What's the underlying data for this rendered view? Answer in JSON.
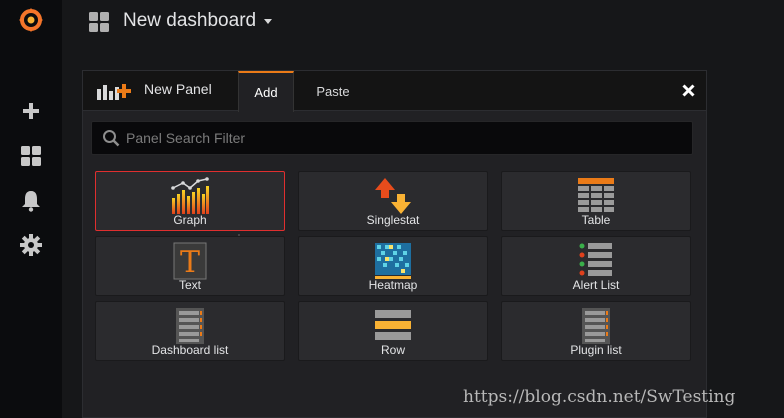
{
  "header": {
    "title": "New dashboard"
  },
  "sidebar": {
    "items": [
      {
        "name": "grafana-logo",
        "icon": "grafana-logo-icon"
      },
      {
        "name": "create",
        "icon": "plus-icon"
      },
      {
        "name": "dashboards",
        "icon": "dashboards-grid-icon"
      },
      {
        "name": "alerting",
        "icon": "bell-icon"
      },
      {
        "name": "configuration",
        "icon": "gear-icon"
      }
    ]
  },
  "panel": {
    "title": "New Panel",
    "tabs": [
      {
        "label": "Add"
      },
      {
        "label": "Paste"
      }
    ],
    "active_tab": "Add",
    "search": {
      "placeholder": "Panel Search Filter",
      "value": ""
    },
    "cards": [
      {
        "label": "Graph",
        "icon": "graph-icon",
        "selected": true
      },
      {
        "label": "Singlestat",
        "icon": "singlestat-icon"
      },
      {
        "label": "Table",
        "icon": "table-icon"
      },
      {
        "label": "Text",
        "icon": "text-icon"
      },
      {
        "label": "Heatmap",
        "icon": "heatmap-icon"
      },
      {
        "label": "Alert List",
        "icon": "alert-list-icon"
      },
      {
        "label": "Dashboard list",
        "icon": "dashboard-list-icon"
      },
      {
        "label": "Row",
        "icon": "row-icon"
      },
      {
        "label": "Plugin list",
        "icon": "plugin-list-icon"
      }
    ]
  },
  "watermark": "https://blog.csdn.net/SwTesting",
  "colors": {
    "accent": "#eb7b18",
    "selected_border": "#e02f2f",
    "background": "#161719"
  }
}
